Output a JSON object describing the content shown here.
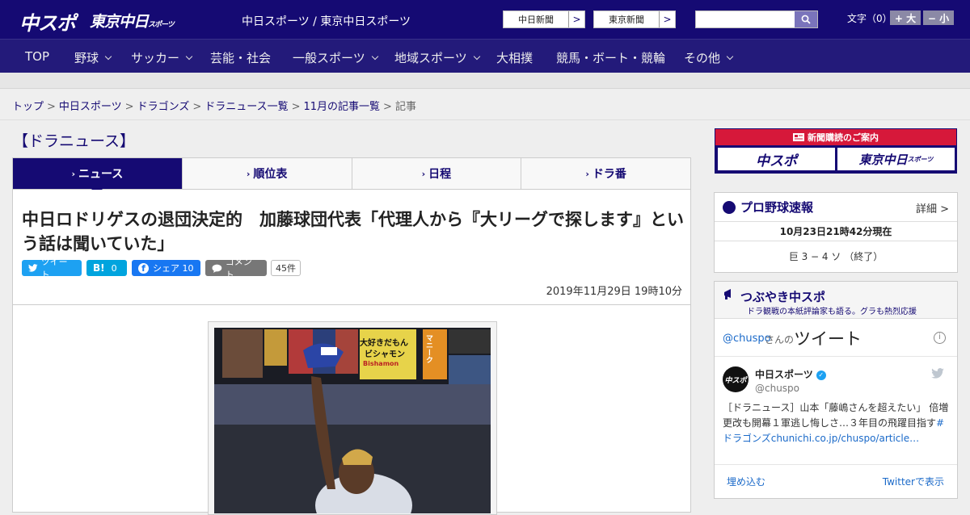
{
  "header": {
    "logo_chuspo": "中スポ",
    "logo_tokyo": "東京中日",
    "logo_tokyo_sub": "スポーツ",
    "tagline": "中日スポーツ / 東京中日スポーツ",
    "btn_chunichi": "中日新聞",
    "btn_tokyo": "東京新聞",
    "arrow": ">",
    "font_label": "文字（0）",
    "font_up": "+ 大",
    "font_down": "− 小"
  },
  "nav": {
    "items": [
      "TOP",
      "野球",
      "サッカー",
      "芸能・社会",
      "一般スポーツ",
      "地域スポーツ",
      "大相撲",
      "競馬・ボート・競輪",
      "その他"
    ]
  },
  "breadcrumb": {
    "items": [
      "トップ",
      "中日スポーツ",
      "ドラゴンズ",
      "ドラニュース一覧",
      "11月の記事一覧"
    ],
    "current": "記事",
    "separator": ">"
  },
  "section_title": "【ドラニュース】",
  "tabs": [
    {
      "label": "ニュース",
      "active": true
    },
    {
      "label": "順位表",
      "active": false
    },
    {
      "label": "日程",
      "active": false
    },
    {
      "label": "ドラ番",
      "active": false
    }
  ],
  "tab_chevron": "›",
  "article": {
    "title": "中日ロドリゲスの退団決定的　加藤球団代表「代理人から『大リーグで探します』という話は聞いていた」",
    "date": "2019年11月29日 19時10分"
  },
  "sns": {
    "tweet": "ツイート",
    "hatena_icon": "B!",
    "hatena_count": "0",
    "fb_share": "シェア",
    "fb_count": "10",
    "comment": "コメント",
    "comment_count": "45件"
  },
  "photo": {
    "banner1": "大好きだもん",
    "banner2": "ビシャモン",
    "banner3": "Bishamon",
    "banner4": "マニーク"
  },
  "ad": {
    "label": "新聞購読のご案内",
    "btn1": "中スポ",
    "btn2": "東京中日",
    "btn2_sub": "スポーツ"
  },
  "baseball": {
    "title": "プロ野球速報",
    "detail": "詳細 >",
    "updated": "10月23日21時42分現在",
    "score": "巨 3 − 4 ソ （終了）"
  },
  "tweets": {
    "title": "つぶやき中スポ",
    "subtitle": "ドラ観戦の本紙評論家も語る。グラも熱烈応援",
    "handle_prefix": "@chuspo",
    "handle_suffix": "さんの",
    "tweet_word": "ツイート",
    "account_name": "中日スポーツ",
    "account_handle": "@chuspo",
    "avatar_text": "中スポ",
    "body_plain": "［ドラニュース］山本「藤嶋さんを超えたい」 倍増更改も開幕１軍逃し悔しさ…３年目の飛躍目指す",
    "body_link": "#ドラゴンズchunichi.co.jp/chuspo/article…",
    "embed": "埋め込む",
    "view_on_twitter": "Twitterで表示"
  },
  "colors": {
    "brand": "#150a73",
    "nav": "#231a7a",
    "twitter": "#1da1f2",
    "hatena": "#00a4de",
    "facebook": "#1877f2",
    "ad_red": "#d6183a"
  }
}
